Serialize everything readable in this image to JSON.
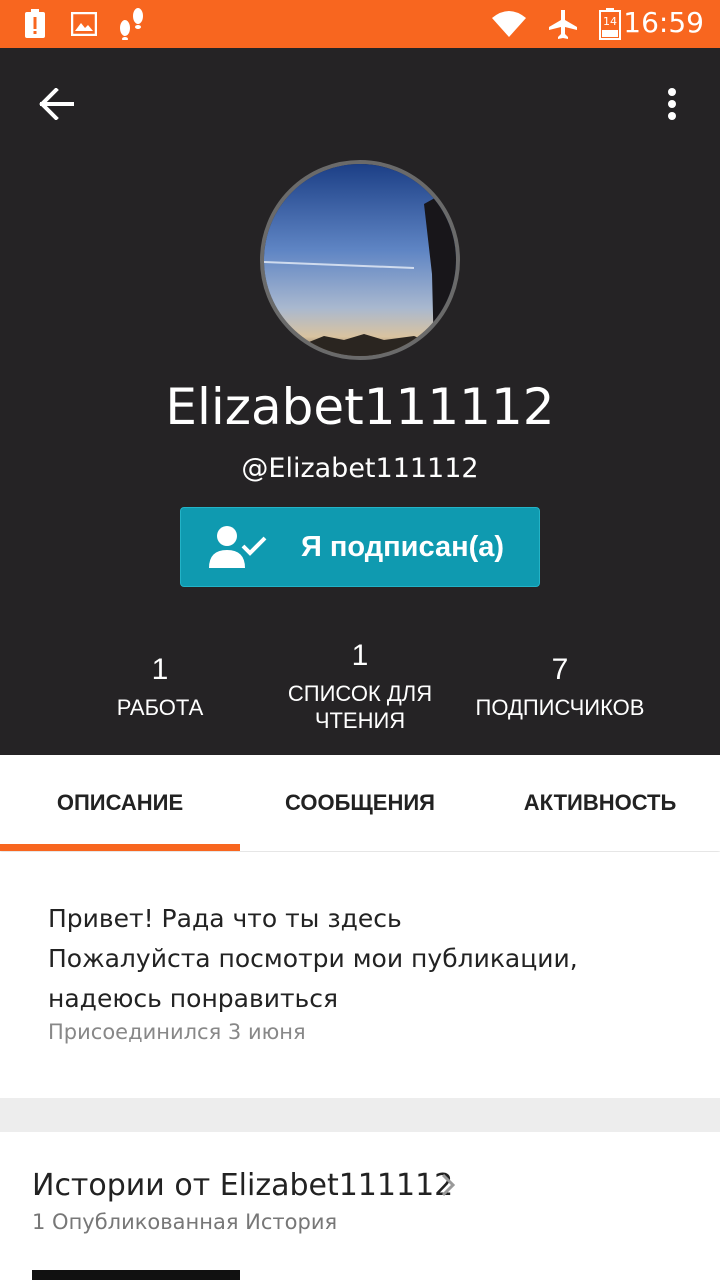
{
  "status_bar": {
    "time": "16:59",
    "battery_level": "14",
    "icons": [
      "alert-icon",
      "image-icon",
      "footsteps-icon",
      "wifi-icon",
      "airplane-icon",
      "battery-icon"
    ],
    "background": "#f8661f"
  },
  "header": {
    "display_name": "Elizabet111112",
    "username": "@Elizabet111112",
    "follow_button_label": "Я подписан(а)",
    "background": "#252325",
    "accent": "#0f9ab0"
  },
  "stats": [
    {
      "value": "1",
      "label": "РАБОТА"
    },
    {
      "value": "1",
      "label": "СПИСОК ДЛЯ ЧТЕНИЯ"
    },
    {
      "value": "7",
      "label": "ПОДПИСЧИКОВ"
    }
  ],
  "tabs": [
    {
      "label": "ОПИСАНИЕ",
      "active": true
    },
    {
      "label": "СООБЩЕНИЯ",
      "active": false
    },
    {
      "label": "АКТИВНОСТЬ",
      "active": false
    }
  ],
  "description": {
    "lines": [
      "Привет! Рада что ты здесь",
      "Пожалуйста посмотри мои публикации,",
      "надеюсь понравиться"
    ],
    "joined": "Присоединился 3 июня"
  },
  "stories": {
    "title": "Истории от Elizabet111112",
    "subtitle": "1 Опубликованная История"
  }
}
